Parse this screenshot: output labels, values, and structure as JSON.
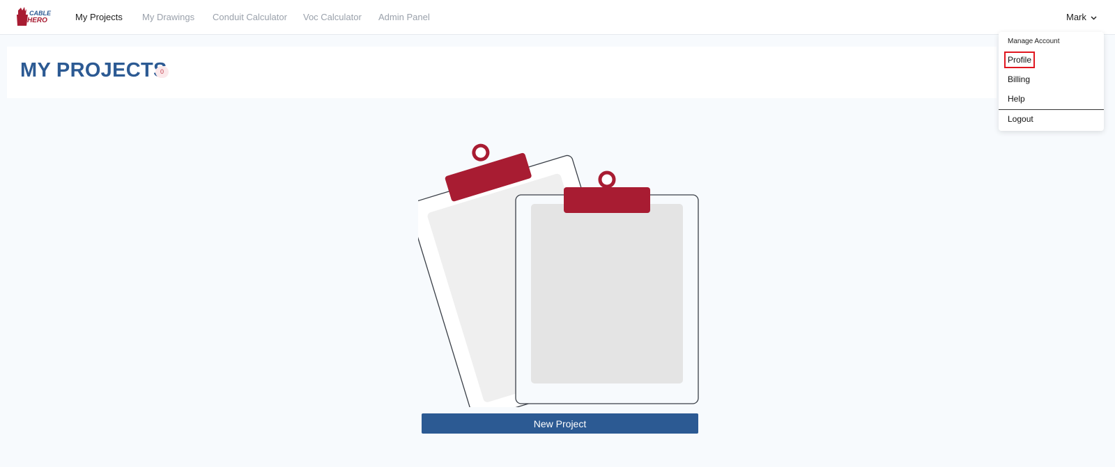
{
  "brand": {
    "logo_line1": "CABLE",
    "logo_line2": "HERO",
    "accent": "#a81c32",
    "primary": "#2c5a93"
  },
  "nav": {
    "items": [
      {
        "label": "My Projects",
        "active": true
      },
      {
        "label": "My Drawings",
        "active": false
      },
      {
        "label": "Conduit Calculator",
        "active": false
      },
      {
        "label": "Voc Calculator",
        "active": false
      },
      {
        "label": "Admin Panel",
        "active": false
      }
    ]
  },
  "user": {
    "name": "Mark",
    "icon": "chevron-down-icon"
  },
  "account_menu": {
    "header": "Manage Account",
    "items": [
      "Profile",
      "Billing",
      "Help"
    ],
    "logout": "Logout",
    "highlighted": "Profile"
  },
  "main": {
    "title": "MY PROJECTS",
    "project_count": "0",
    "empty_state_icon": "clipboards-illustration",
    "new_project_label": "New Project"
  }
}
